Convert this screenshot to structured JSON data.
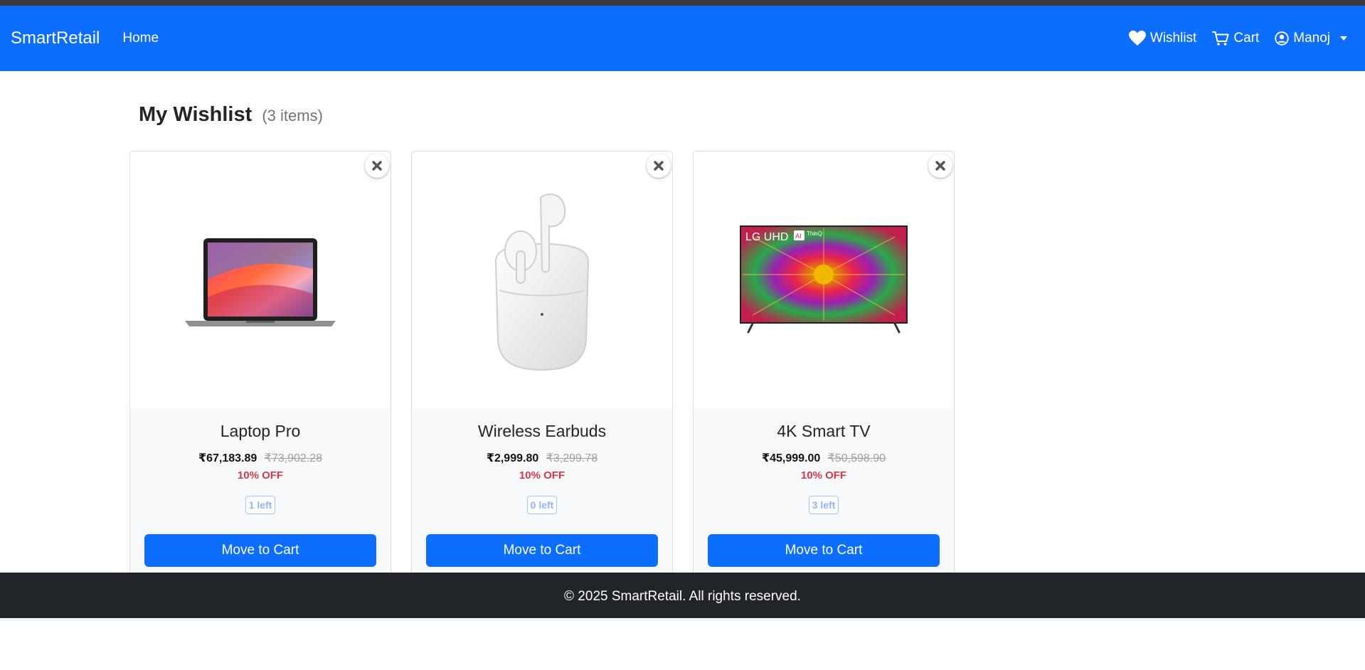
{
  "navbar": {
    "brand": "SmartRetail",
    "home_label": "Home",
    "wishlist_label": "Wishlist",
    "cart_label": "Cart",
    "user_label": "Manoj",
    "color": "#0d6efd"
  },
  "page": {
    "title": "My Wishlist",
    "count": "(3 items)"
  },
  "items": [
    {
      "name": "Laptop Pro",
      "price": "₹67,183.89",
      "old_price": "₹73,902.28",
      "discount": "10% OFF",
      "stock": "1 left",
      "button": "Move to Cart",
      "image_icon": "laptop-image"
    },
    {
      "name": "Wireless Earbuds",
      "price": "₹2,999.80",
      "old_price": "₹3,299.78",
      "discount": "10% OFF",
      "stock": "0 left",
      "button": "Move to Cart",
      "image_icon": "earbuds-image"
    },
    {
      "name": "4K Smart TV",
      "price": "₹45,999.00",
      "old_price": "₹50,598.90",
      "discount": "10% OFF",
      "stock": "3 left",
      "button": "Move to Cart",
      "image_icon": "tv-image",
      "tv_brand": "LG UHD",
      "tv_ai": "AI",
      "tv_sub": "ThinQ"
    }
  ],
  "footer": {
    "text": "© 2025 SmartRetail. All rights reserved.",
    "color": "#212529"
  }
}
